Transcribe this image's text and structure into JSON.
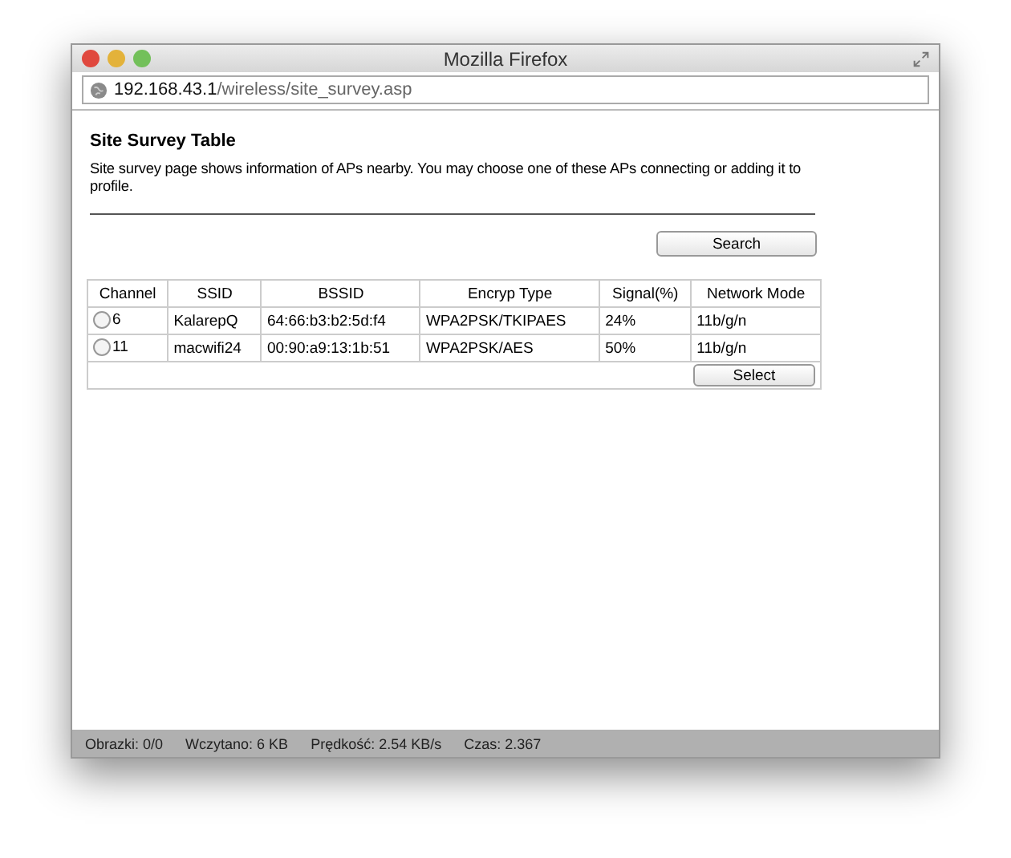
{
  "window": {
    "title": "Mozilla Firefox"
  },
  "address_bar": {
    "host": "192.168.43.1",
    "path": "/wireless/site_survey.asp"
  },
  "page": {
    "title": "Site Survey Table",
    "description": "Site survey page shows information of APs nearby. You may choose one of these APs connecting or adding it to profile.",
    "search_button": "Search",
    "select_button": "Select"
  },
  "table": {
    "columns": [
      "Channel",
      "SSID",
      "BSSID",
      "Encryp Type",
      "Signal(%)",
      "Network Mode"
    ],
    "rows": [
      {
        "selected": false,
        "cells": [
          "6",
          "KalarepQ",
          "64:66:b3:b2:5d:f4",
          "WPA2PSK/TKIPAES",
          "24%",
          "11b/g/n"
        ]
      },
      {
        "selected": false,
        "cells": [
          "11",
          "macwifi24",
          "00:90:a9:13:1b:51",
          "WPA2PSK/AES",
          "50%",
          "11b/g/n"
        ]
      }
    ]
  },
  "status_bar": [
    "Obrazki: 0/0",
    "Wczytano: 6 KB",
    "Prędkość: 2.54 KB/s",
    "Czas: 2.367"
  ]
}
